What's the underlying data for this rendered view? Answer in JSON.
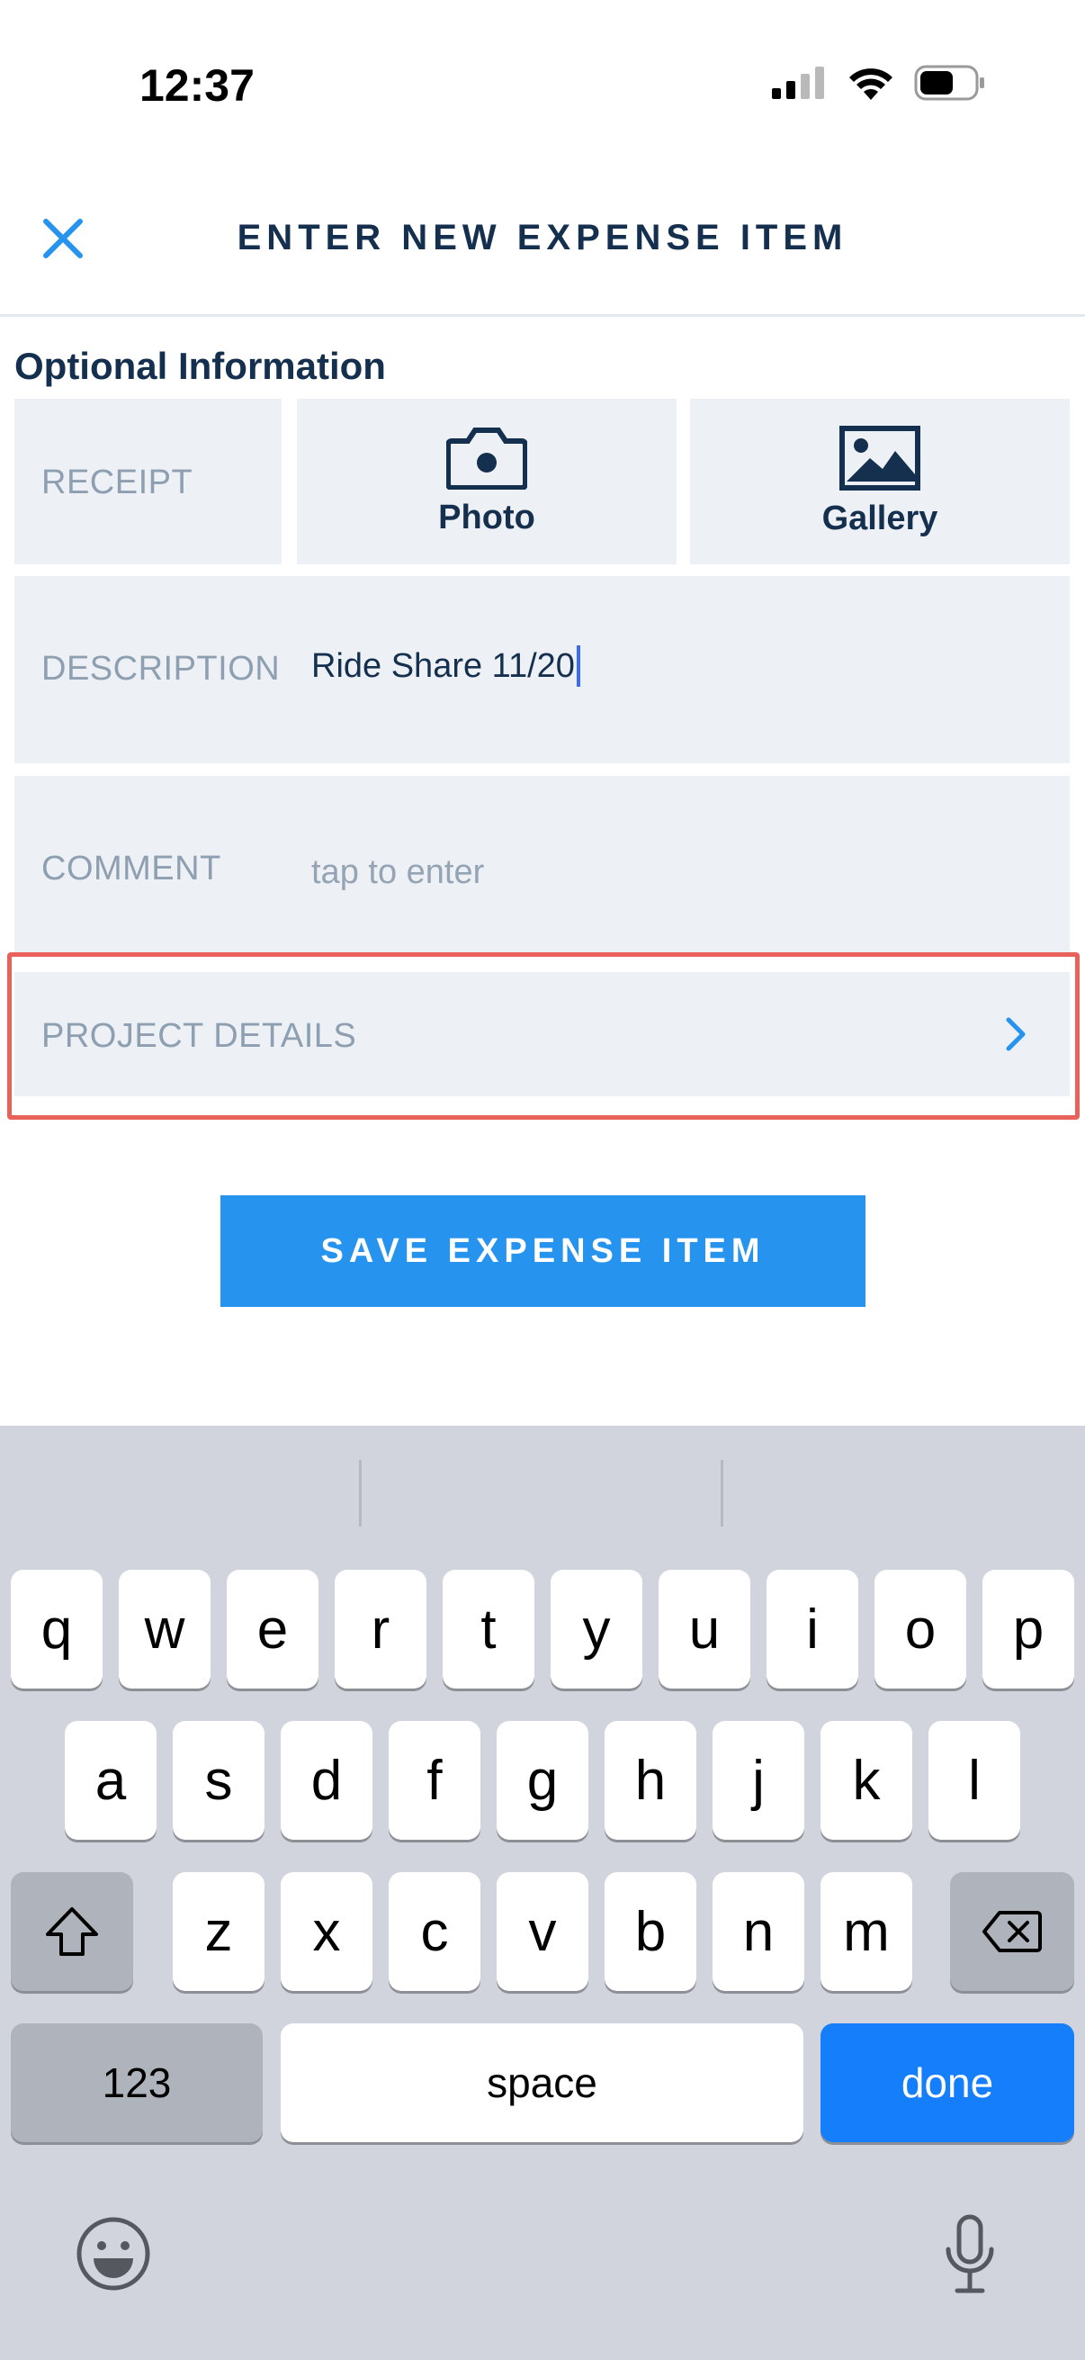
{
  "status_bar": {
    "time": "12:37"
  },
  "header": {
    "title": "ENTER NEW EXPENSE ITEM",
    "close_icon": "close-icon"
  },
  "section": {
    "title": "Optional Information"
  },
  "receipt": {
    "label": "RECEIPT",
    "photo_label": "Photo",
    "gallery_label": "Gallery"
  },
  "description": {
    "label": "DESCRIPTION",
    "value": "Ride Share 11/20"
  },
  "comment": {
    "label": "COMMENT",
    "placeholder": "tap to enter"
  },
  "project_details": {
    "label": "PROJECT DETAILS"
  },
  "save_button": {
    "label": "SAVE EXPENSE ITEM"
  },
  "keyboard": {
    "row1": [
      "q",
      "w",
      "e",
      "r",
      "t",
      "y",
      "u",
      "i",
      "o",
      "p"
    ],
    "row2": [
      "a",
      "s",
      "d",
      "f",
      "g",
      "h",
      "j",
      "k",
      "l"
    ],
    "row3": [
      "z",
      "x",
      "c",
      "v",
      "b",
      "n",
      "m"
    ],
    "numbers_label": "123",
    "space_label": "space",
    "done_label": "done"
  },
  "colors": {
    "accent": "#2693ef",
    "primary_text": "#15304f",
    "highlight_border": "#e8615b",
    "keyboard_done": "#147efb"
  }
}
